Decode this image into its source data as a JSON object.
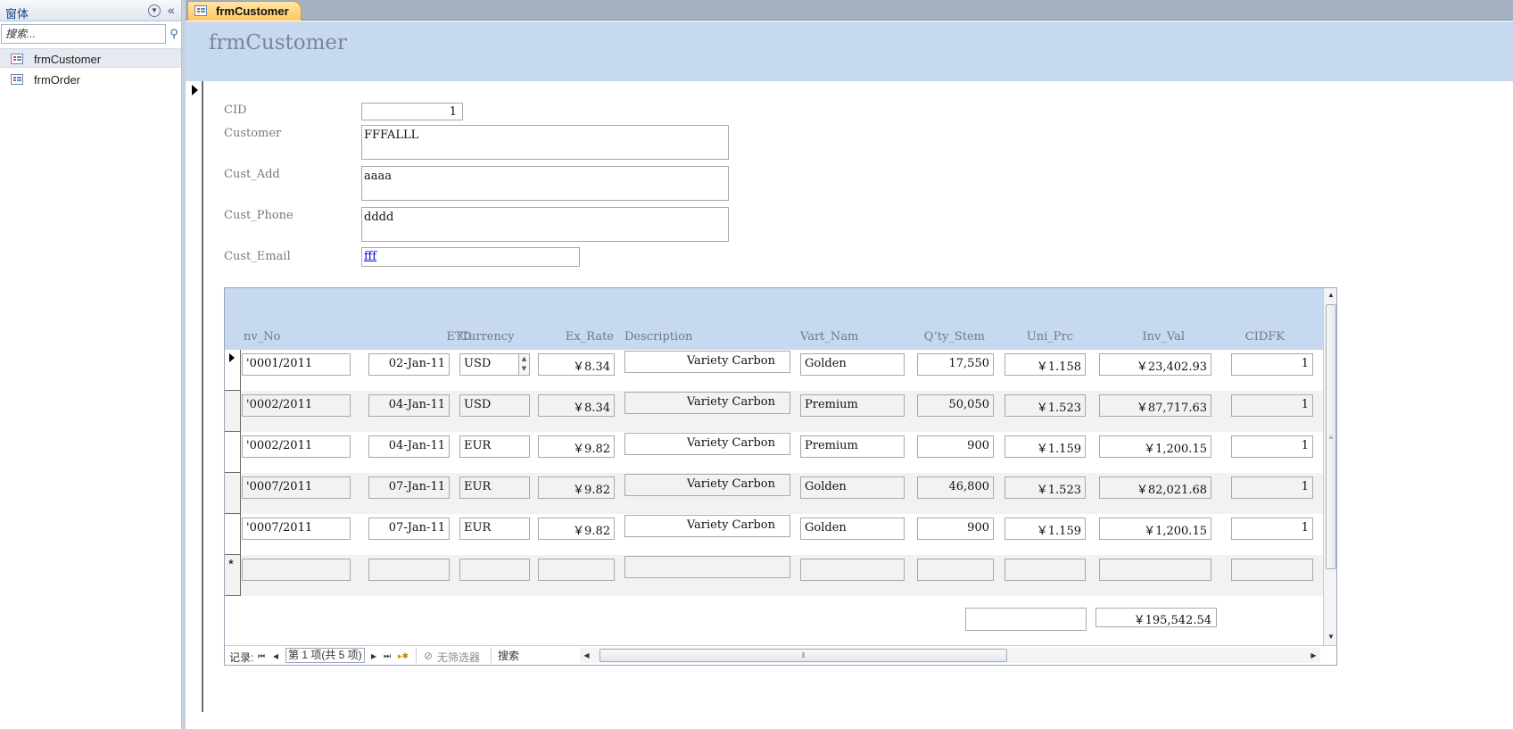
{
  "nav_pane": {
    "title": "窗体",
    "search_placeholder": "搜索...",
    "items": [
      {
        "label": "frmCustomer",
        "selected": true
      },
      {
        "label": "frmOrder",
        "selected": false
      }
    ]
  },
  "document_tab": {
    "label": "frmCustomer"
  },
  "form": {
    "title": "frmCustomer",
    "fields": {
      "cid": {
        "label": "CID",
        "value": "1"
      },
      "customer": {
        "label": "Customer",
        "value": "FFFALLL"
      },
      "cust_add": {
        "label": "Cust_Add",
        "value": "aaaa"
      },
      "cust_phone": {
        "label": "Cust_Phone",
        "value": "dddd"
      },
      "cust_email": {
        "label": "Cust_Email",
        "value": "fff"
      }
    }
  },
  "subform": {
    "columns": {
      "inv_no": "nv_No",
      "etd": "ETD",
      "currency": "Currency",
      "ex_rate": "Ex_Rate",
      "description": "Description",
      "vart_nam": "Vart_Nam",
      "qty_stem": "Q’ty_Stem",
      "uni_prc": "Uni_Prc",
      "inv_val": "Inv_Val",
      "cidfk": "CIDFK"
    },
    "rows": [
      {
        "inv_no": "'0001/2011",
        "etd": "02-Jan-11",
        "currency": "USD",
        "ex_rate": "￥8.34",
        "description": "Variety Carbon",
        "vart_nam": "Golden",
        "qty_stem": "17,550",
        "uni_prc": "￥1.158",
        "inv_val": "￥23,402.93",
        "cidfk": "1"
      },
      {
        "inv_no": "'0002/2011",
        "etd": "04-Jan-11",
        "currency": "USD",
        "ex_rate": "￥8.34",
        "description": "Variety Carbon",
        "vart_nam": "Premium",
        "qty_stem": "50,050",
        "uni_prc": "￥1.523",
        "inv_val": "￥87,717.63",
        "cidfk": "1"
      },
      {
        "inv_no": "'0002/2011",
        "etd": "04-Jan-11",
        "currency": "EUR",
        "ex_rate": "￥9.82",
        "description": "Variety Carbon",
        "vart_nam": "Premium",
        "qty_stem": "900",
        "uni_prc": "￥1.159",
        "inv_val": "￥1,200.15",
        "cidfk": "1"
      },
      {
        "inv_no": "'0007/2011",
        "etd": "07-Jan-11",
        "currency": "EUR",
        "ex_rate": "￥9.82",
        "description": "Variety Carbon",
        "vart_nam": "Golden",
        "qty_stem": "46,800",
        "uni_prc": "￥1.523",
        "inv_val": "￥82,021.68",
        "cidfk": "1"
      },
      {
        "inv_no": "'0007/2011",
        "etd": "07-Jan-11",
        "currency": "EUR",
        "ex_rate": "￥9.82",
        "description": "Variety Carbon",
        "vart_nam": "Golden",
        "qty_stem": "900",
        "uni_prc": "￥1.159",
        "inv_val": "￥1,200.15",
        "cidfk": "1"
      }
    ],
    "new_record_marker": "*",
    "footer_total": "￥195,542.54"
  },
  "record_nav": {
    "label": "记录:",
    "first": "⏮",
    "prev": "◂",
    "position": "第 1 项(共 5 项)",
    "next": "▸",
    "last": "⏭",
    "new": "▸✱",
    "filter_label": "无筛选器",
    "search_placeholder": "搜索"
  },
  "colors": {
    "header_band": "#c6d9f1",
    "tab_active": "#ffc760",
    "label_gray": "#7a7a7a"
  },
  "icons": [
    "form-icon",
    "search-icon",
    "chevron-down-icon",
    "collapse-icon",
    "record-pointer-icon",
    "filter-icon"
  ]
}
